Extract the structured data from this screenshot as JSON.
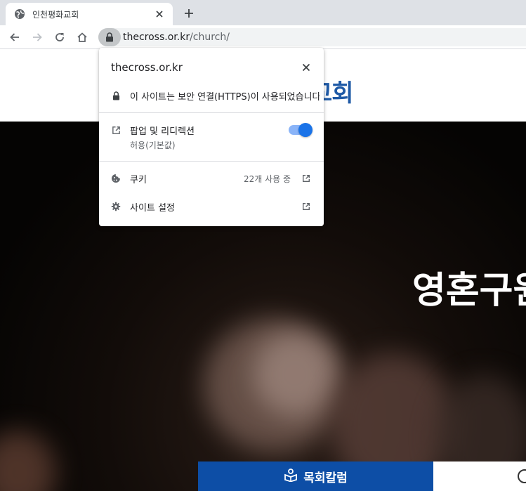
{
  "browser": {
    "tab": {
      "title": "인천평화교회",
      "favicon_icon": "globe-icon",
      "close_icon": "close-icon"
    },
    "new_tab_icon": "plus-icon",
    "toolbar": {
      "back_icon": "arrow-left-icon",
      "forward_icon": "arrow-right-icon",
      "reload_icon": "reload-icon",
      "home_icon": "home-icon"
    },
    "omnibox": {
      "lock_icon": "lock-icon",
      "host": "thecross.or.kr",
      "path": "/church/"
    }
  },
  "site_info_popup": {
    "title": "thecross.or.kr",
    "connection_text": "이 사이트는 보안 연결(HTTPS)이 사용되었습니다.",
    "popups_label": "팝업 및 리디렉션",
    "popups_sublabel": "허용(기본값)",
    "popups_toggle_on": true,
    "cookies_label": "쿠키",
    "cookies_count": "22개 사용 중",
    "site_settings_label": "사이트 설정"
  },
  "site": {
    "logo_text_visible": "교회",
    "hero_headline": "영혼구원",
    "bottom_tab_label": "목회칼럼"
  },
  "colors": {
    "tabstrip_bg": "#dee1e6",
    "accent_blue": "#1a73e8",
    "site_blue": "#0d4ea6",
    "logo_blue": "#1f5aa6"
  }
}
